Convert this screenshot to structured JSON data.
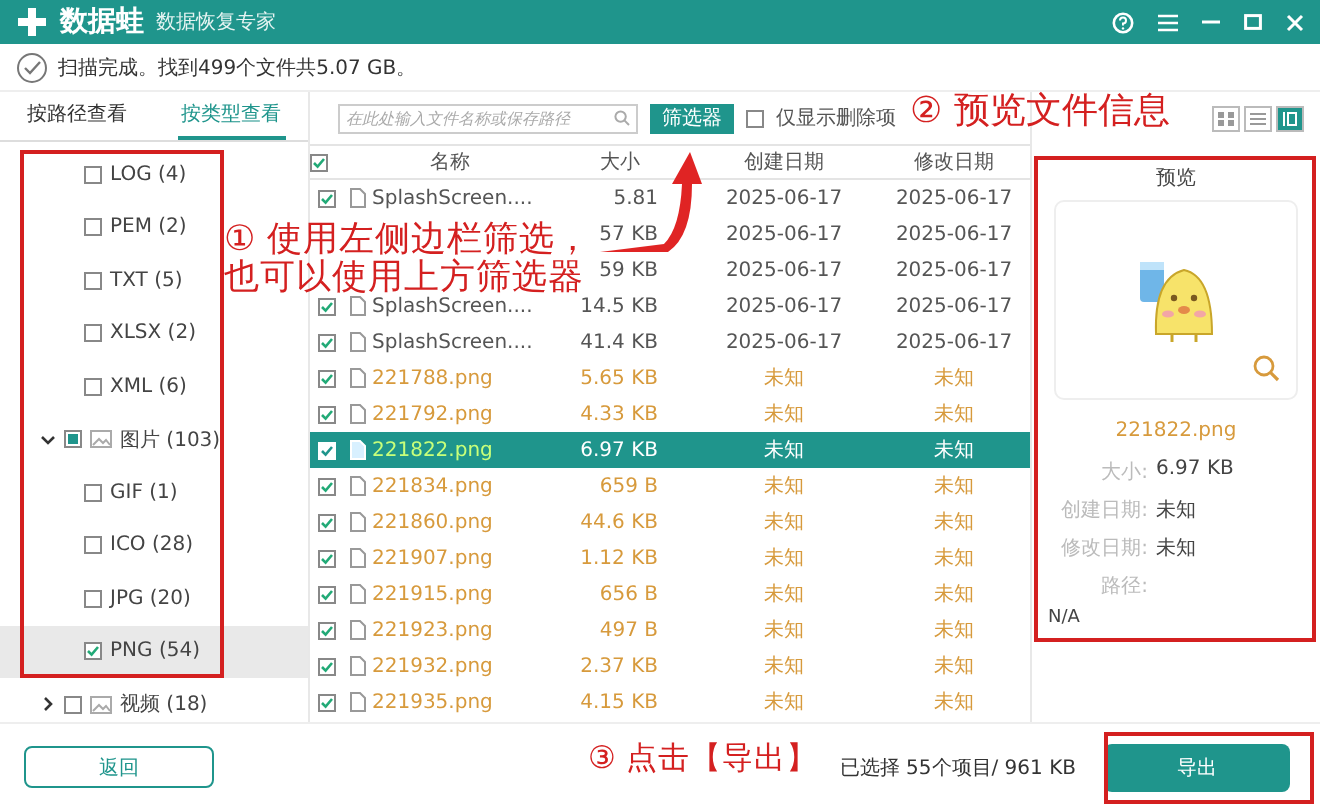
{
  "app": {
    "name": "数据蛙",
    "subtitle": "数据恢复专家"
  },
  "status": {
    "text": "扫描完成。找到499个文件共5.07 GB。"
  },
  "view_tabs": [
    {
      "label": "按路径查看",
      "selected": false
    },
    {
      "label": "按类型查看",
      "selected": true
    }
  ],
  "search": {
    "placeholder": "在此处输入文件名称或保存路径"
  },
  "filter_button": "筛选器",
  "deleted_only": {
    "label": "仅显示删除项",
    "checked": false
  },
  "view_modes": [
    {
      "selected": false
    },
    {
      "selected": false
    },
    {
      "selected": true
    }
  ],
  "sidebar": {
    "items": [
      {
        "label": "LOG (4)",
        "checked": false,
        "selected": false
      },
      {
        "label": "PEM (2)",
        "checked": false,
        "selected": false
      },
      {
        "label": "TXT (5)",
        "checked": false,
        "selected": false
      },
      {
        "label": "XLSX (2)",
        "checked": false,
        "selected": false
      },
      {
        "label": "XML (6)",
        "checked": false,
        "selected": false
      },
      {
        "kind": "group",
        "label": "图片 (103)",
        "checked": true,
        "selected": false,
        "expanded": true,
        "children": [
          {
            "label": "GIF (1)",
            "checked": false,
            "selected": false
          },
          {
            "label": "ICO (28)",
            "checked": false,
            "selected": false
          },
          {
            "label": "JPG (20)",
            "checked": false,
            "selected": false
          },
          {
            "label": "PNG (54)",
            "checked": true,
            "selected": true
          }
        ]
      },
      {
        "kind": "group",
        "label": "视频 (18)",
        "checked": false,
        "selected": false,
        "expanded": false
      }
    ]
  },
  "table": {
    "columns": [
      "名称",
      "大小",
      "创建日期",
      "修改日期"
    ],
    "all_checked": true,
    "rows": [
      {
        "name": "SplashScreen....",
        "size": "5.81",
        "created": "2025-06-17",
        "modified": "2025-06-17",
        "checked": true,
        "selected": false,
        "recovered": false
      },
      {
        "size": "57 KB",
        "created": "2025-06-17",
        "modified": "2025-06-17",
        "selected": false,
        "recovered": false
      },
      {
        "size": "59 KB",
        "created": "2025-06-17",
        "modified": "2025-06-17",
        "selected": false,
        "recovered": false
      },
      {
        "name": "SplashScreen....",
        "size": "14.5 KB",
        "created": "2025-06-17",
        "modified": "2025-06-17",
        "checked": true,
        "selected": false,
        "recovered": false
      },
      {
        "name": "SplashScreen....",
        "size": "41.4 KB",
        "created": "2025-06-17",
        "modified": "2025-06-17",
        "checked": true,
        "selected": false,
        "recovered": false
      },
      {
        "name": "221788.png",
        "size": "5.65 KB",
        "created": "未知",
        "modified": "未知",
        "checked": true,
        "selected": false,
        "recovered": true
      },
      {
        "name": "221792.png",
        "size": "4.33 KB",
        "created": "未知",
        "modified": "未知",
        "checked": true,
        "selected": false,
        "recovered": true
      },
      {
        "name": "221822.png",
        "size": "6.97 KB",
        "created": "未知",
        "modified": "未知",
        "checked": true,
        "selected": true,
        "recovered": true
      },
      {
        "name": "221834.png",
        "size": "659  B",
        "created": "未知",
        "modified": "未知",
        "checked": true,
        "selected": false,
        "recovered": true
      },
      {
        "name": "221860.png",
        "size": "44.6 KB",
        "created": "未知",
        "modified": "未知",
        "checked": true,
        "selected": false,
        "recovered": true
      },
      {
        "name": "221907.png",
        "size": "1.12 KB",
        "created": "未知",
        "modified": "未知",
        "checked": true,
        "selected": false,
        "recovered": true
      },
      {
        "name": "221915.png",
        "size": "656  B",
        "created": "未知",
        "modified": "未知",
        "checked": true,
        "selected": false,
        "recovered": true
      },
      {
        "name": "221923.png",
        "size": "497  B",
        "created": "未知",
        "modified": "未知",
        "checked": true,
        "selected": false,
        "recovered": true
      },
      {
        "name": "221932.png",
        "size": "2.37 KB",
        "created": "未知",
        "modified": "未知",
        "checked": true,
        "selected": false,
        "recovered": true
      },
      {
        "name": "221935.png",
        "size": "4.15 KB",
        "created": "未知",
        "modified": "未知",
        "checked": true,
        "selected": false,
        "recovered": true
      }
    ]
  },
  "preview": {
    "title": "预览",
    "file_name": "221822.png",
    "fields": [
      {
        "label": "大小:",
        "value": "6.97 KB"
      },
      {
        "label": "创建日期:",
        "value": "未知"
      },
      {
        "label": "修改日期:",
        "value": "未知"
      },
      {
        "label": "路径:"
      }
    ],
    "path": "N/A"
  },
  "footer": {
    "back_button": "返回",
    "selection": "已选择 55个项目/ 961 KB",
    "export_button": "导出"
  },
  "annotations": [
    {
      "text": "① 使用左侧边栏筛选，"
    },
    {
      "text": "也可以使用上方筛选器"
    },
    {
      "text": "② 预览文件信息"
    },
    {
      "text": "③  点击【导出】"
    }
  ]
}
